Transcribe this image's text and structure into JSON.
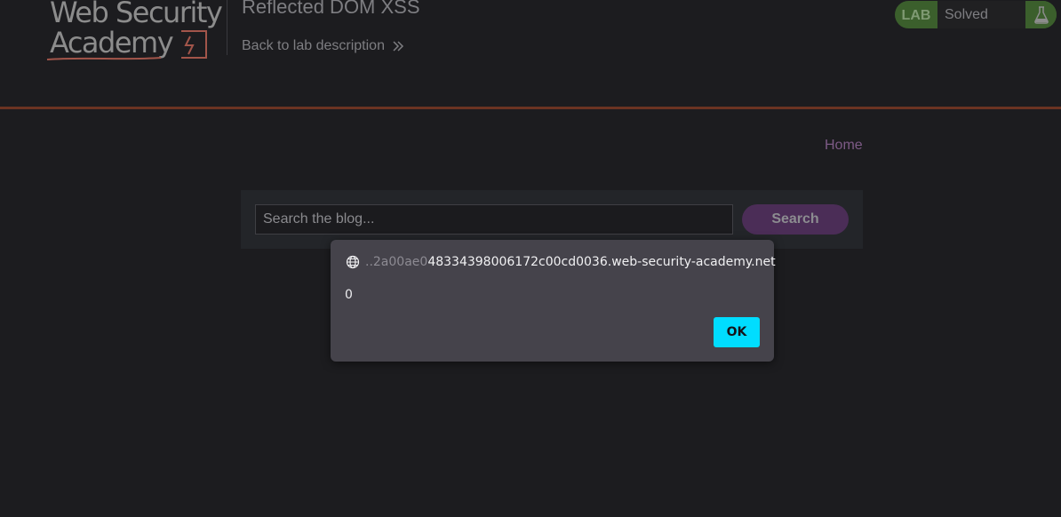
{
  "header": {
    "logo": {
      "line1": "Web Security",
      "line2": "Academy"
    },
    "lab_title": "Reflected DOM XSS",
    "back_link": "Back to lab description"
  },
  "status": {
    "badge": "LAB",
    "value": "Solved",
    "icon": "flask-icon",
    "badge_color": "#3b5f2c"
  },
  "nav": {
    "home": "Home"
  },
  "search": {
    "placeholder": "Search the blog...",
    "button": "Search",
    "button_color": "#4b2d57"
  },
  "dialog": {
    "origin_faded": "..2a00ae0",
    "origin_main": "48334398006172c00cd0036.web-security-academy.net",
    "message": "0",
    "ok": "OK",
    "ok_color": "#00ddff"
  }
}
